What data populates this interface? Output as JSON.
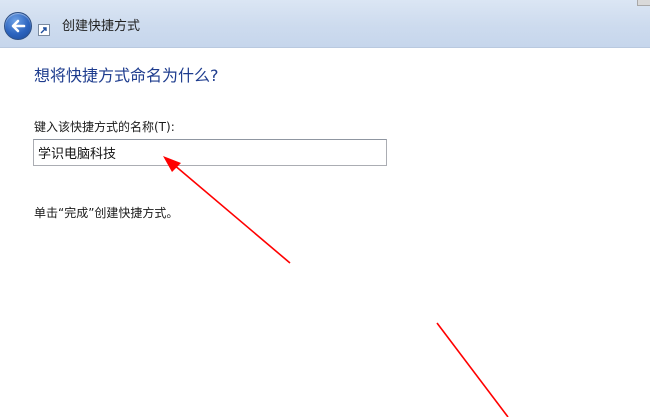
{
  "window": {
    "title": "创建快捷方式"
  },
  "page": {
    "heading": "想将快捷方式命名为什么?",
    "field_label": "键入该快捷方式的名称(T):",
    "name_value": "学识电脑科技",
    "hint": "单击“完成”创建快捷方式。"
  },
  "icons": {
    "back": "back-arrow-icon",
    "shortcut": "shortcut-icon"
  },
  "colors": {
    "heading": "#1e3c8e",
    "annotation_arrow": "#ff0000",
    "titlebar": "#cddbee"
  }
}
